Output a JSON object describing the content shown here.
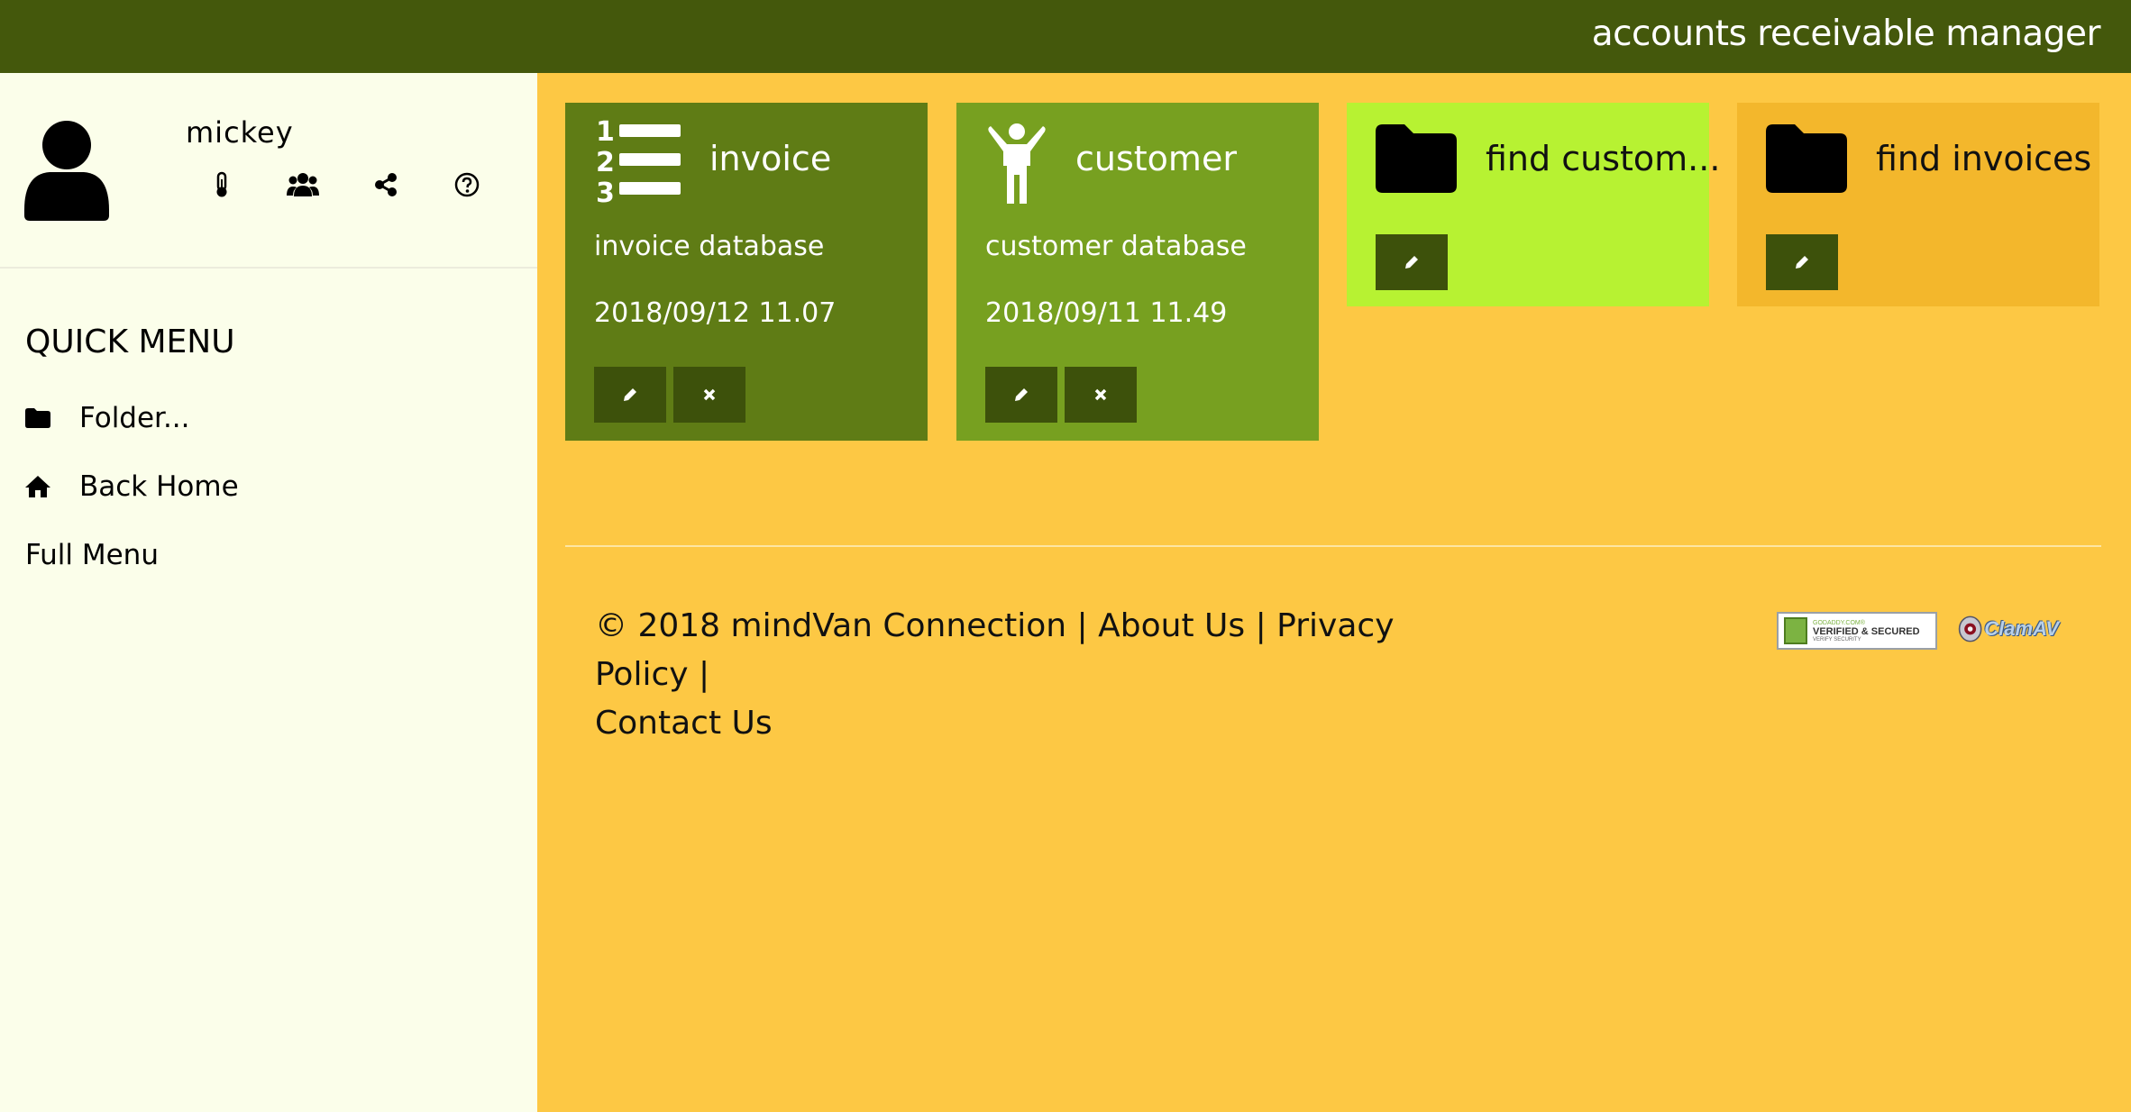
{
  "header": {
    "title": "accounts receivable manager"
  },
  "profile": {
    "username": "mickey",
    "icons": [
      "thermometer-icon",
      "users-icon",
      "share-icon",
      "help-icon"
    ]
  },
  "quick_menu": {
    "title": "QUICK MENU",
    "items": [
      {
        "label": "Folder...",
        "icon": "folder-icon"
      },
      {
        "label": "Back Home",
        "icon": "home-icon"
      },
      {
        "label": "Full Menu",
        "icon": ""
      }
    ]
  },
  "tiles": [
    {
      "title": "invoice",
      "subtitle": "invoice database",
      "date": "2018/09/12 11.07",
      "icon": "numbered-list-icon",
      "color": "#5f7c15"
    },
    {
      "title": "customer",
      "subtitle": "customer database",
      "date": "2018/09/11 11.49",
      "icon": "person-icon",
      "color": "#77a020"
    },
    {
      "title": "find custom...",
      "icon": "folder-icon",
      "color": "#b7f232"
    },
    {
      "title": "find invoices",
      "icon": "folder-icon",
      "color": "#f3b72c"
    }
  ],
  "footer": {
    "copyright": "© 2018 mindVan Connection",
    "sep": "|",
    "links": [
      "About Us",
      "Privacy Policy",
      "Contact Us"
    ]
  },
  "badges": {
    "godaddy": {
      "line1": "GODADDY.COM®",
      "line2": "VERIFIED & SECURED",
      "line3": "VERIFY SECURITY"
    },
    "clamav": {
      "text": "ClamAV"
    }
  },
  "colors": {
    "topbar": "#44580c",
    "sidebar": "#fbfeea",
    "main": "#fdc844",
    "action_button": "#3d510b"
  }
}
